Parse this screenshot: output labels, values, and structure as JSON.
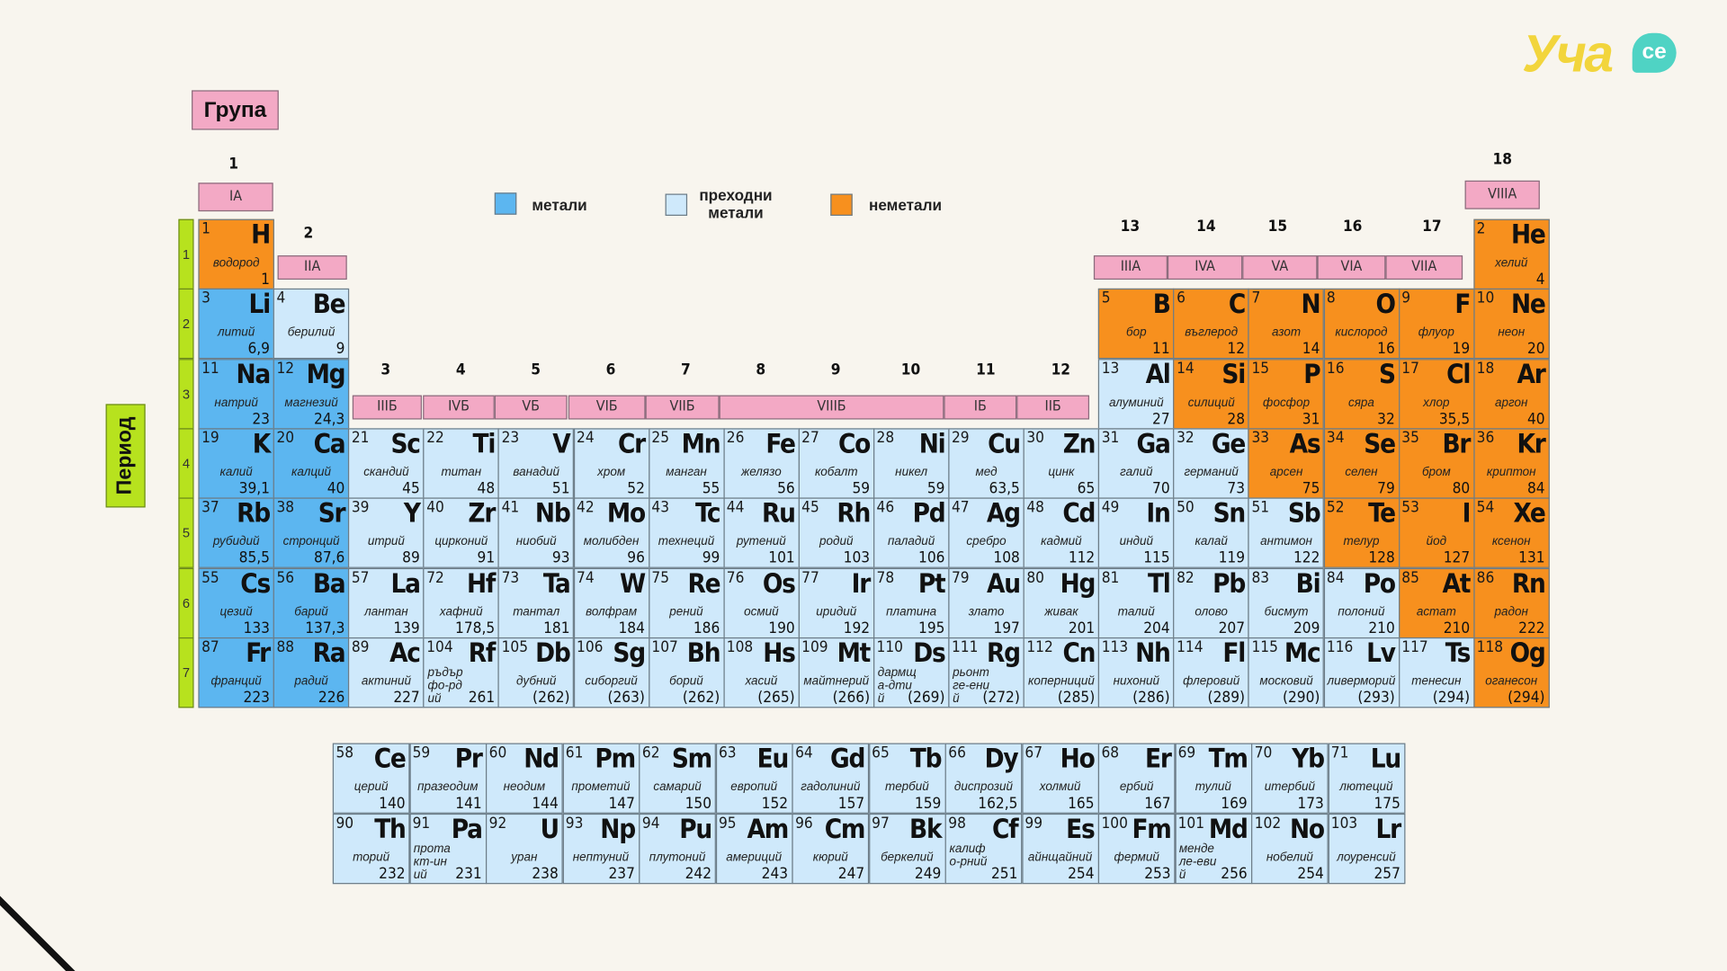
{
  "group_label": "Група",
  "period_label": "Период",
  "logo_text": "Уча",
  "logo_badge": "се",
  "legend": [
    {
      "label": "метали",
      "color": "#5cb6f0"
    },
    {
      "label": "преходни метали",
      "color": "#cfe9fb"
    },
    {
      "label": "неметали",
      "color": "#f7901e"
    }
  ],
  "group_numbers": [
    "1",
    "2",
    "3",
    "4",
    "5",
    "6",
    "7",
    "8",
    "9",
    "10",
    "11",
    "12",
    "13",
    "14",
    "15",
    "16",
    "17",
    "18"
  ],
  "roman_groups": [
    "IA",
    "IIA",
    "IIIБ",
    "IVБ",
    "VБ",
    "VIБ",
    "VIIБ",
    "VIIIБ",
    "IБ",
    "IIБ",
    "IIIA",
    "IVA",
    "VA",
    "VIA",
    "VIIA",
    "VIIIA"
  ],
  "period_numbers": [
    "1",
    "2",
    "3",
    "4",
    "5",
    "6",
    "7"
  ],
  "elements": [
    {
      "n": "1",
      "s": "H",
      "name": "водород",
      "m": "1",
      "g": 1,
      "p": 1,
      "t": "nonmetal"
    },
    {
      "n": "2",
      "s": "He",
      "name": "хелий",
      "m": "4",
      "g": 18,
      "p": 1,
      "t": "nonmetal"
    },
    {
      "n": "3",
      "s": "Li",
      "name": "литий",
      "m": "6,9",
      "g": 1,
      "p": 2,
      "t": "metal"
    },
    {
      "n": "4",
      "s": "Be",
      "name": "берилий",
      "m": "9",
      "g": 2,
      "p": 2,
      "t": "trans"
    },
    {
      "n": "5",
      "s": "B",
      "name": "бор",
      "m": "11",
      "g": 13,
      "p": 2,
      "t": "nonmetal"
    },
    {
      "n": "6",
      "s": "C",
      "name": "въглерод",
      "m": "12",
      "g": 14,
      "p": 2,
      "t": "nonmetal"
    },
    {
      "n": "7",
      "s": "N",
      "name": "азот",
      "m": "14",
      "g": 15,
      "p": 2,
      "t": "nonmetal"
    },
    {
      "n": "8",
      "s": "O",
      "name": "кислород",
      "m": "16",
      "g": 16,
      "p": 2,
      "t": "nonmetal"
    },
    {
      "n": "9",
      "s": "F",
      "name": "флуор",
      "m": "19",
      "g": 17,
      "p": 2,
      "t": "nonmetal"
    },
    {
      "n": "10",
      "s": "Ne",
      "name": "неон",
      "m": "20",
      "g": 18,
      "p": 2,
      "t": "nonmetal"
    },
    {
      "n": "11",
      "s": "Na",
      "name": "натрий",
      "m": "23",
      "g": 1,
      "p": 3,
      "t": "metal"
    },
    {
      "n": "12",
      "s": "Mg",
      "name": "магнезий",
      "m": "24,3",
      "g": 2,
      "p": 3,
      "t": "metal"
    },
    {
      "n": "13",
      "s": "Al",
      "name": "алуминий",
      "m": "27",
      "g": 13,
      "p": 3,
      "t": "trans"
    },
    {
      "n": "14",
      "s": "Si",
      "name": "силиций",
      "m": "28",
      "g": 14,
      "p": 3,
      "t": "nonmetal"
    },
    {
      "n": "15",
      "s": "P",
      "name": "фосфор",
      "m": "31",
      "g": 15,
      "p": 3,
      "t": "nonmetal"
    },
    {
      "n": "16",
      "s": "S",
      "name": "сяра",
      "m": "32",
      "g": 16,
      "p": 3,
      "t": "nonmetal"
    },
    {
      "n": "17",
      "s": "Cl",
      "name": "хлор",
      "m": "35,5",
      "g": 17,
      "p": 3,
      "t": "nonmetal"
    },
    {
      "n": "18",
      "s": "Ar",
      "name": "аргон",
      "m": "40",
      "g": 18,
      "p": 3,
      "t": "nonmetal"
    },
    {
      "n": "19",
      "s": "K",
      "name": "калий",
      "m": "39,1",
      "g": 1,
      "p": 4,
      "t": "metal"
    },
    {
      "n": "20",
      "s": "Ca",
      "name": "калций",
      "m": "40",
      "g": 2,
      "p": 4,
      "t": "metal"
    },
    {
      "n": "21",
      "s": "Sc",
      "name": "скандий",
      "m": "45",
      "g": 3,
      "p": 4,
      "t": "trans"
    },
    {
      "n": "22",
      "s": "Ti",
      "name": "титан",
      "m": "48",
      "g": 4,
      "p": 4,
      "t": "trans"
    },
    {
      "n": "23",
      "s": "V",
      "name": "ванадий",
      "m": "51",
      "g": 5,
      "p": 4,
      "t": "trans"
    },
    {
      "n": "24",
      "s": "Cr",
      "name": "хром",
      "m": "52",
      "g": 6,
      "p": 4,
      "t": "trans"
    },
    {
      "n": "25",
      "s": "Mn",
      "name": "манган",
      "m": "55",
      "g": 7,
      "p": 4,
      "t": "trans"
    },
    {
      "n": "26",
      "s": "Fe",
      "name": "желязо",
      "m": "56",
      "g": 8,
      "p": 4,
      "t": "trans"
    },
    {
      "n": "27",
      "s": "Co",
      "name": "кобалт",
      "m": "59",
      "g": 9,
      "p": 4,
      "t": "trans"
    },
    {
      "n": "28",
      "s": "Ni",
      "name": "никел",
      "m": "59",
      "g": 10,
      "p": 4,
      "t": "trans"
    },
    {
      "n": "29",
      "s": "Cu",
      "name": "мед",
      "m": "63,5",
      "g": 11,
      "p": 4,
      "t": "trans"
    },
    {
      "n": "30",
      "s": "Zn",
      "name": "цинк",
      "m": "65",
      "g": 12,
      "p": 4,
      "t": "trans"
    },
    {
      "n": "31",
      "s": "Ga",
      "name": "галий",
      "m": "70",
      "g": 13,
      "p": 4,
      "t": "trans"
    },
    {
      "n": "32",
      "s": "Ge",
      "name": "германий",
      "m": "73",
      "g": 14,
      "p": 4,
      "t": "trans"
    },
    {
      "n": "33",
      "s": "As",
      "name": "арсен",
      "m": "75",
      "g": 15,
      "p": 4,
      "t": "nonmetal"
    },
    {
      "n": "34",
      "s": "Se",
      "name": "селен",
      "m": "79",
      "g": 16,
      "p": 4,
      "t": "nonmetal"
    },
    {
      "n": "35",
      "s": "Br",
      "name": "бром",
      "m": "80",
      "g": 17,
      "p": 4,
      "t": "nonmetal"
    },
    {
      "n": "36",
      "s": "Kr",
      "name": "криптон",
      "m": "84",
      "g": 18,
      "p": 4,
      "t": "nonmetal"
    },
    {
      "n": "37",
      "s": "Rb",
      "name": "рубидий",
      "m": "85,5",
      "g": 1,
      "p": 5,
      "t": "metal"
    },
    {
      "n": "38",
      "s": "Sr",
      "name": "стронций",
      "m": "87,6",
      "g": 2,
      "p": 5,
      "t": "metal"
    },
    {
      "n": "39",
      "s": "Y",
      "name": "итрий",
      "m": "89",
      "g": 3,
      "p": 5,
      "t": "trans"
    },
    {
      "n": "40",
      "s": "Zr",
      "name": "цирконий",
      "m": "91",
      "g": 4,
      "p": 5,
      "t": "trans"
    },
    {
      "n": "41",
      "s": "Nb",
      "name": "ниобий",
      "m": "93",
      "g": 5,
      "p": 5,
      "t": "trans"
    },
    {
      "n": "42",
      "s": "Mo",
      "name": "молибден",
      "m": "96",
      "g": 6,
      "p": 5,
      "t": "trans"
    },
    {
      "n": "43",
      "s": "Tc",
      "name": "технеций",
      "m": "99",
      "g": 7,
      "p": 5,
      "t": "trans"
    },
    {
      "n": "44",
      "s": "Ru",
      "name": "рутений",
      "m": "101",
      "g": 8,
      "p": 5,
      "t": "trans"
    },
    {
      "n": "45",
      "s": "Rh",
      "name": "родий",
      "m": "103",
      "g": 9,
      "p": 5,
      "t": "trans"
    },
    {
      "n": "46",
      "s": "Pd",
      "name": "паладий",
      "m": "106",
      "g": 10,
      "p": 5,
      "t": "trans"
    },
    {
      "n": "47",
      "s": "Ag",
      "name": "сребро",
      "m": "108",
      "g": 11,
      "p": 5,
      "t": "trans"
    },
    {
      "n": "48",
      "s": "Cd",
      "name": "кадмий",
      "m": "112",
      "g": 12,
      "p": 5,
      "t": "trans"
    },
    {
      "n": "49",
      "s": "In",
      "name": "индий",
      "m": "115",
      "g": 13,
      "p": 5,
      "t": "trans"
    },
    {
      "n": "50",
      "s": "Sn",
      "name": "калай",
      "m": "119",
      "g": 14,
      "p": 5,
      "t": "trans"
    },
    {
      "n": "51",
      "s": "Sb",
      "name": "антимон",
      "m": "122",
      "g": 15,
      "p": 5,
      "t": "trans"
    },
    {
      "n": "52",
      "s": "Te",
      "name": "телур",
      "m": "128",
      "g": 16,
      "p": 5,
      "t": "nonmetal"
    },
    {
      "n": "53",
      "s": "I",
      "name": "йод",
      "m": "127",
      "g": 17,
      "p": 5,
      "t": "nonmetal"
    },
    {
      "n": "54",
      "s": "Xe",
      "name": "ксенон",
      "m": "131",
      "g": 18,
      "p": 5,
      "t": "nonmetal"
    },
    {
      "n": "55",
      "s": "Cs",
      "name": "цезий",
      "m": "133",
      "g": 1,
      "p": 6,
      "t": "metal"
    },
    {
      "n": "56",
      "s": "Ba",
      "name": "барий",
      "m": "137,3",
      "g": 2,
      "p": 6,
      "t": "metal"
    },
    {
      "n": "57",
      "s": "La",
      "name": "лантан",
      "m": "139",
      "g": 3,
      "p": 6,
      "t": "trans"
    },
    {
      "n": "72",
      "s": "Hf",
      "name": "хафний",
      "m": "178,5",
      "g": 4,
      "p": 6,
      "t": "trans"
    },
    {
      "n": "73",
      "s": "Ta",
      "name": "тантал",
      "m": "181",
      "g": 5,
      "p": 6,
      "t": "trans"
    },
    {
      "n": "74",
      "s": "W",
      "name": "волфрам",
      "m": "184",
      "g": 6,
      "p": 6,
      "t": "trans"
    },
    {
      "n": "75",
      "s": "Re",
      "name": "рений",
      "m": "186",
      "g": 7,
      "p": 6,
      "t": "trans"
    },
    {
      "n": "76",
      "s": "Os",
      "name": "осмий",
      "m": "190",
      "g": 8,
      "p": 6,
      "t": "trans"
    },
    {
      "n": "77",
      "s": "Ir",
      "name": "иридий",
      "m": "192",
      "g": 9,
      "p": 6,
      "t": "trans"
    },
    {
      "n": "78",
      "s": "Pt",
      "name": "платина",
      "m": "195",
      "g": 10,
      "p": 6,
      "t": "trans"
    },
    {
      "n": "79",
      "s": "Au",
      "name": "злато",
      "m": "197",
      "g": 11,
      "p": 6,
      "t": "trans"
    },
    {
      "n": "80",
      "s": "Hg",
      "name": "живак",
      "m": "201",
      "g": 12,
      "p": 6,
      "t": "trans"
    },
    {
      "n": "81",
      "s": "Tl",
      "name": "талий",
      "m": "204",
      "g": 13,
      "p": 6,
      "t": "trans"
    },
    {
      "n": "82",
      "s": "Pb",
      "name": "олово",
      "m": "207",
      "g": 14,
      "p": 6,
      "t": "trans"
    },
    {
      "n": "83",
      "s": "Bi",
      "name": "бисмут",
      "m": "209",
      "g": 15,
      "p": 6,
      "t": "trans"
    },
    {
      "n": "84",
      "s": "Po",
      "name": "полоний",
      "m": "210",
      "g": 16,
      "p": 6,
      "t": "trans"
    },
    {
      "n": "85",
      "s": "At",
      "name": "астат",
      "m": "210",
      "g": 17,
      "p": 6,
      "t": "nonmetal"
    },
    {
      "n": "86",
      "s": "Rn",
      "name": "радон",
      "m": "222",
      "g": 18,
      "p": 6,
      "t": "nonmetal"
    },
    {
      "n": "87",
      "s": "Fr",
      "name": "франций",
      "m": "223",
      "g": 1,
      "p": 7,
      "t": "metal"
    },
    {
      "n": "88",
      "s": "Ra",
      "name": "радий",
      "m": "226",
      "g": 2,
      "p": 7,
      "t": "metal"
    },
    {
      "n": "89",
      "s": "Ac",
      "name": "актиний",
      "m": "227",
      "g": 3,
      "p": 7,
      "t": "trans"
    },
    {
      "n": "104",
      "s": "Rf",
      "name": "ръдърфо-рдий",
      "m": "261",
      "g": 4,
      "p": 7,
      "t": "trans",
      "two": true
    },
    {
      "n": "105",
      "s": "Db",
      "name": "дубний",
      "m": "(262)",
      "g": 5,
      "p": 7,
      "t": "trans"
    },
    {
      "n": "106",
      "s": "Sg",
      "name": "сиборгий",
      "m": "(263)",
      "g": 6,
      "p": 7,
      "t": "trans"
    },
    {
      "n": "107",
      "s": "Bh",
      "name": "борий",
      "m": "(262)",
      "g": 7,
      "p": 7,
      "t": "trans"
    },
    {
      "n": "108",
      "s": "Hs",
      "name": "хасий",
      "m": "(265)",
      "g": 8,
      "p": 7,
      "t": "trans"
    },
    {
      "n": "109",
      "s": "Mt",
      "name": "майтнерий",
      "m": "(266)",
      "g": 9,
      "p": 7,
      "t": "trans"
    },
    {
      "n": "110",
      "s": "Ds",
      "name": "дармща-дтий",
      "m": "(269)",
      "g": 10,
      "p": 7,
      "t": "trans",
      "two": true
    },
    {
      "n": "111",
      "s": "Rg",
      "name": "рьонтге-ений",
      "m": "(272)",
      "g": 11,
      "p": 7,
      "t": "trans",
      "two": true
    },
    {
      "n": "112",
      "s": "Cn",
      "name": "коперниций",
      "m": "(285)",
      "g": 12,
      "p": 7,
      "t": "trans"
    },
    {
      "n": "113",
      "s": "Nh",
      "name": "нихоний",
      "m": "(286)",
      "g": 13,
      "p": 7,
      "t": "trans"
    },
    {
      "n": "114",
      "s": "Fl",
      "name": "флеровий",
      "m": "(289)",
      "g": 14,
      "p": 7,
      "t": "trans"
    },
    {
      "n": "115",
      "s": "Mc",
      "name": "московий",
      "m": "(290)",
      "g": 15,
      "p": 7,
      "t": "trans"
    },
    {
      "n": "116",
      "s": "Lv",
      "name": "ливерморий",
      "m": "(293)",
      "g": 16,
      "p": 7,
      "t": "trans"
    },
    {
      "n": "117",
      "s": "Ts",
      "name": "тенесин",
      "m": "(294)",
      "g": 17,
      "p": 7,
      "t": "trans"
    },
    {
      "n": "118",
      "s": "Og",
      "name": "оганесон",
      "m": "(294)",
      "g": 18,
      "p": 7,
      "t": "nonmetal"
    }
  ],
  "lanthanides": [
    {
      "n": "58",
      "s": "Ce",
      "name": "церий",
      "m": "140"
    },
    {
      "n": "59",
      "s": "Pr",
      "name": "празеодим",
      "m": "141"
    },
    {
      "n": "60",
      "s": "Nd",
      "name": "неодим",
      "m": "144"
    },
    {
      "n": "61",
      "s": "Pm",
      "name": "прометий",
      "m": "147"
    },
    {
      "n": "62",
      "s": "Sm",
      "name": "самарий",
      "m": "150"
    },
    {
      "n": "63",
      "s": "Eu",
      "name": "европий",
      "m": "152"
    },
    {
      "n": "64",
      "s": "Gd",
      "name": "гадолиний",
      "m": "157"
    },
    {
      "n": "65",
      "s": "Tb",
      "name": "тербий",
      "m": "159"
    },
    {
      "n": "66",
      "s": "Dy",
      "name": "диспрозий",
      "m": "162,5"
    },
    {
      "n": "67",
      "s": "Ho",
      "name": "холмий",
      "m": "165"
    },
    {
      "n": "68",
      "s": "Er",
      "name": "ербий",
      "m": "167"
    },
    {
      "n": "69",
      "s": "Tm",
      "name": "тулий",
      "m": "169"
    },
    {
      "n": "70",
      "s": "Yb",
      "name": "итербий",
      "m": "173"
    },
    {
      "n": "71",
      "s": "Lu",
      "name": "лютеций",
      "m": "175"
    }
  ],
  "actinides": [
    {
      "n": "90",
      "s": "Th",
      "name": "торий",
      "m": "232"
    },
    {
      "n": "91",
      "s": "Pa",
      "name": "протакт-иний",
      "m": "231",
      "two": true
    },
    {
      "n": "92",
      "s": "U",
      "name": "уран",
      "m": "238"
    },
    {
      "n": "93",
      "s": "Np",
      "name": "нептуний",
      "m": "237"
    },
    {
      "n": "94",
      "s": "Pu",
      "name": "плутоний",
      "m": "242"
    },
    {
      "n": "95",
      "s": "Am",
      "name": "америций",
      "m": "243"
    },
    {
      "n": "96",
      "s": "Cm",
      "name": "кюрий",
      "m": "247"
    },
    {
      "n": "97",
      "s": "Bk",
      "name": "беркелий",
      "m": "249"
    },
    {
      "n": "98",
      "s": "Cf",
      "name": "калифо-рний",
      "m": "251",
      "two": true
    },
    {
      "n": "99",
      "s": "Es",
      "name": "айнщайний",
      "m": "254"
    },
    {
      "n": "100",
      "s": "Fm",
      "name": "фермий",
      "m": "253"
    },
    {
      "n": "101",
      "s": "Md",
      "name": "менделе-евий",
      "m": "256",
      "two": true
    },
    {
      "n": "102",
      "s": "No",
      "name": "нобелий",
      "m": "254"
    },
    {
      "n": "103",
      "s": "Lr",
      "name": "лоуренсий",
      "m": "257"
    }
  ]
}
